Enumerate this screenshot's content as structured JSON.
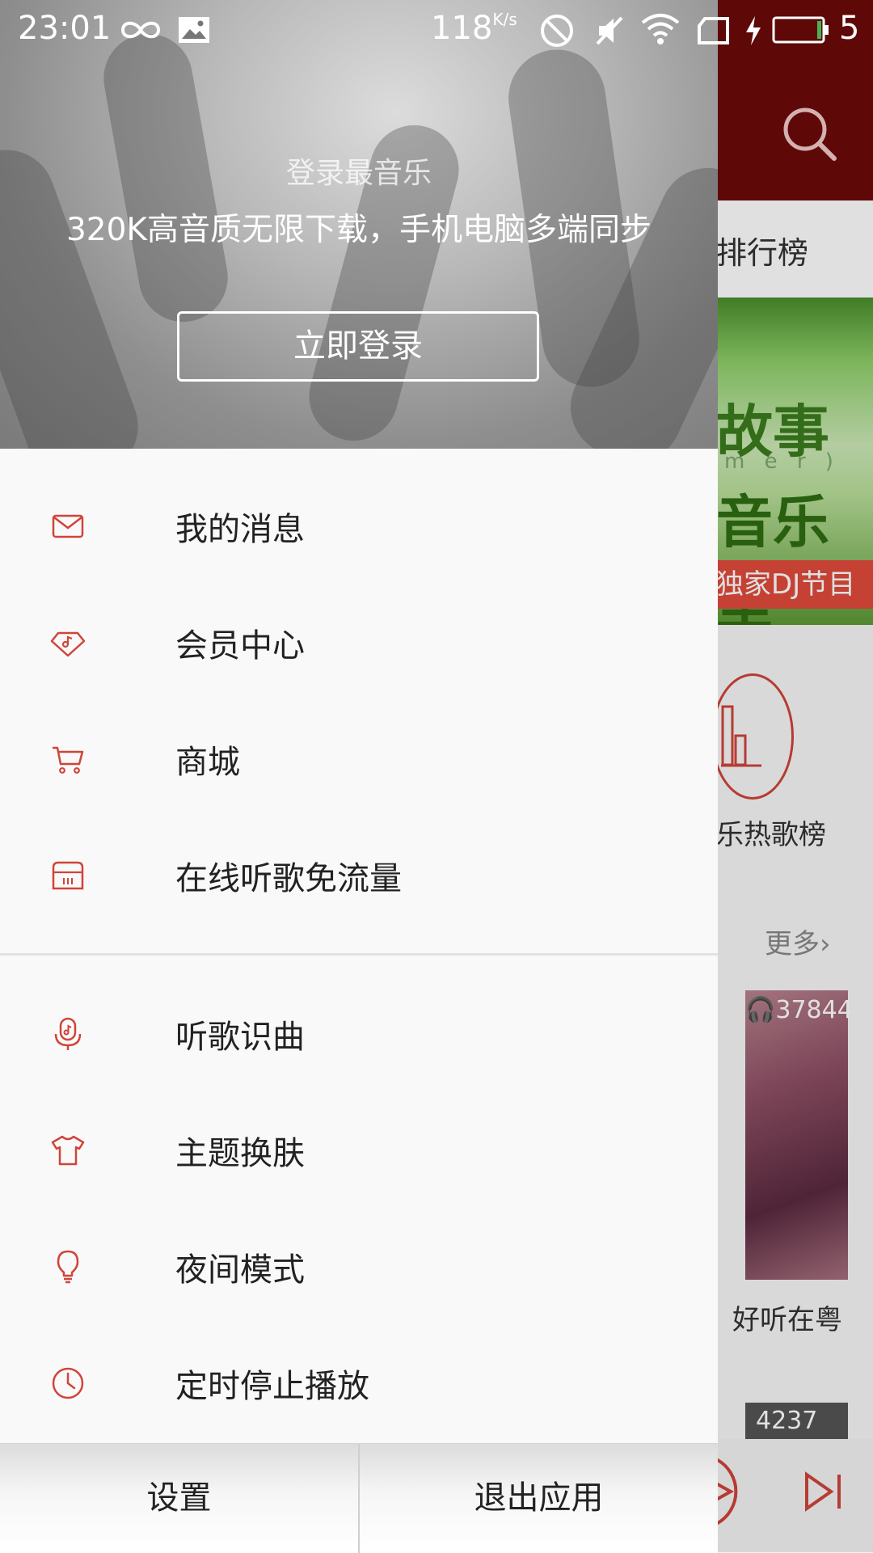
{
  "status_bar": {
    "time": "23:01",
    "net_speed": "118",
    "net_unit": "K/s",
    "battery_level": "5"
  },
  "background_app": {
    "tab_rank": "排行榜",
    "banner_line1": "故事",
    "banner_line2": "m e r )",
    "banner_line3": "音乐里",
    "banner_tag": "独家DJ节目",
    "chart_label": "乐热歌榜",
    "more_label": "更多",
    "card1_count": "37844",
    "card1_title": "好听在粤",
    "card2_count": "4237"
  },
  "drawer": {
    "hero": {
      "title": "登录最音乐",
      "subtitle": "320K高音质无限下载，手机电脑多端同步",
      "login_button": "立即登录"
    },
    "menu_group1": [
      {
        "label": "我的消息",
        "icon": "mail-icon"
      },
      {
        "label": "会员中心",
        "icon": "vip-diamond-icon"
      },
      {
        "label": "商城",
        "icon": "cart-icon"
      },
      {
        "label": "在线听歌免流量",
        "icon": "sim-card-icon"
      }
    ],
    "menu_group2": [
      {
        "label": "听歌识曲",
        "icon": "microphone-icon"
      },
      {
        "label": "主题换肤",
        "icon": "tshirt-icon"
      },
      {
        "label": "夜间模式",
        "icon": "lightbulb-icon"
      },
      {
        "label": "定时停止播放",
        "icon": "clock-icon"
      }
    ],
    "footer": {
      "settings": "设置",
      "exit": "退出应用"
    }
  },
  "colors": {
    "accent": "#d0443a",
    "header_bg": "#6b0a0a"
  }
}
